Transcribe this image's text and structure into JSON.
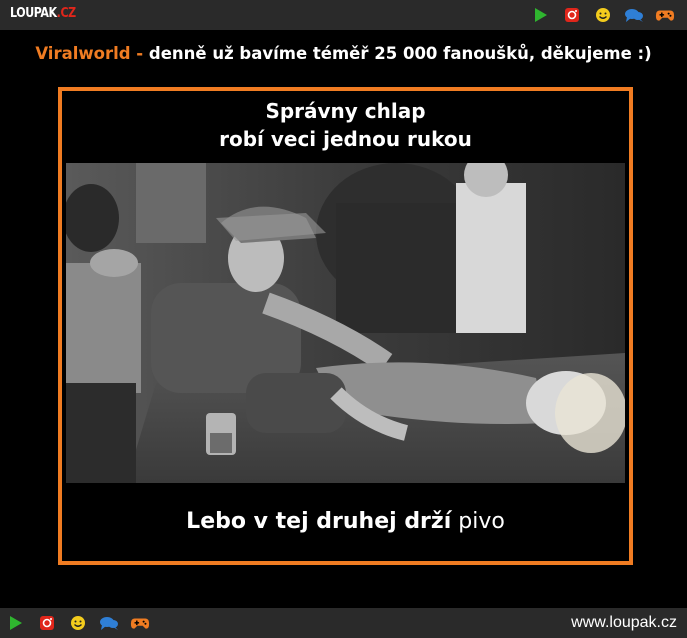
{
  "header": {
    "logo_main": "LOUPAK",
    "logo_tld": ".CZ",
    "icons": [
      "play-icon",
      "instagram-icon",
      "smiley-icon",
      "chat-icon",
      "gamepad-icon"
    ]
  },
  "banner": {
    "brand": "Viralworld",
    "separator": " - ",
    "text": "denně už bavíme téměř 25 000 fanoušků, děkujeme :)"
  },
  "meme": {
    "top_line1": "Správny chlap",
    "top_line2": "robí veci jednou rukou",
    "bottom_bold": "Lebo v tej druhej drží",
    "bottom_normal": "pivo"
  },
  "footer": {
    "site": "www.loupak.cz",
    "icons": [
      "play-icon",
      "instagram-icon",
      "smiley-icon",
      "chat-icon",
      "gamepad-icon"
    ]
  },
  "colors": {
    "accent": "#f07c22",
    "bar_bg": "#2a2a2a",
    "logo_red": "#e0261b",
    "play_green": "#2fb52f",
    "instagram_red": "#e0261b",
    "smiley_yellow": "#f3cc1d",
    "chat_blue": "#2f7fd6",
    "gamepad_orange": "#f07c22"
  }
}
